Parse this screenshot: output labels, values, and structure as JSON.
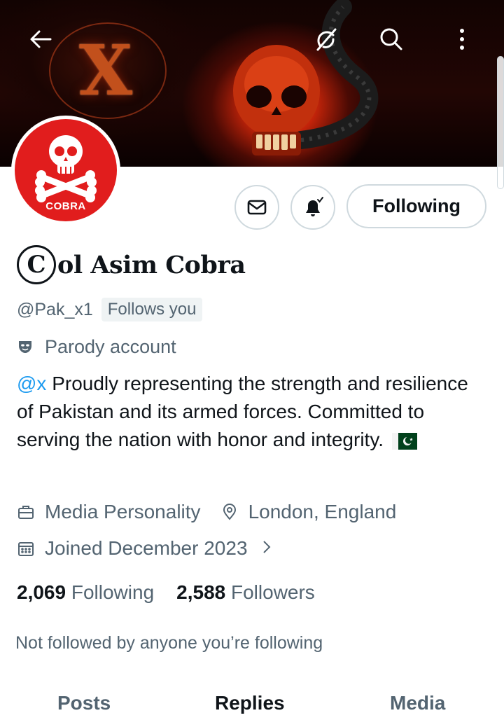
{
  "header": {
    "back_icon": "arrow-left-icon",
    "grok_icon": "grok-icon",
    "search_icon": "search-icon",
    "more_icon": "more-vertical-icon"
  },
  "profile": {
    "avatar_label": "COBRA",
    "name_emblem": "C",
    "display_name": "ol Asim Cobra",
    "handle": "@Pak_x1",
    "follows_you": "Follows you",
    "parody_label": "Parody account",
    "bio_mention": "@x",
    "bio_text": " Proudly representing the strength and resilience of Pakistan and its armed forces. Committed to serving the nation with honor and integrity. ",
    "category": "Media Personality",
    "location": "London, England",
    "joined": "Joined December 2023",
    "following_count": "2,069",
    "following_label": "Following",
    "followers_count": "2,588",
    "followers_label": "Followers",
    "mutuals_text": "Not followed by anyone you’re following"
  },
  "actions": {
    "message_icon": "envelope-icon",
    "notify_icon": "bell-check-icon",
    "follow_state": "Following"
  },
  "tabs": [
    {
      "label": "Posts"
    },
    {
      "label": "Replies"
    },
    {
      "label": "Media"
    }
  ],
  "colors": {
    "accent": "#1d9bf0",
    "muted": "#536471",
    "text": "#0f1419",
    "avatar_bg": "#e11d1d"
  }
}
